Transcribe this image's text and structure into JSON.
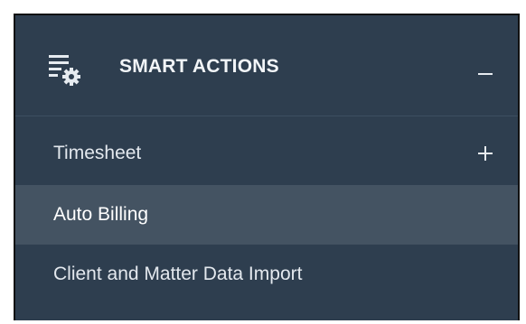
{
  "panel": {
    "title": "SMART ACTIONS",
    "header_icon": "list-settings-icon",
    "collapse_icon": "minus-icon",
    "colors": {
      "background": "#2e3e4f",
      "active_item": "#445362",
      "text": "#e6ebf0"
    }
  },
  "menu": {
    "items": [
      {
        "label": "Timesheet",
        "expand_icon": "plus-icon",
        "active": false
      },
      {
        "label": "Auto Billing",
        "active": true
      },
      {
        "label": "Client and Matter Data Import",
        "active": false
      }
    ]
  }
}
